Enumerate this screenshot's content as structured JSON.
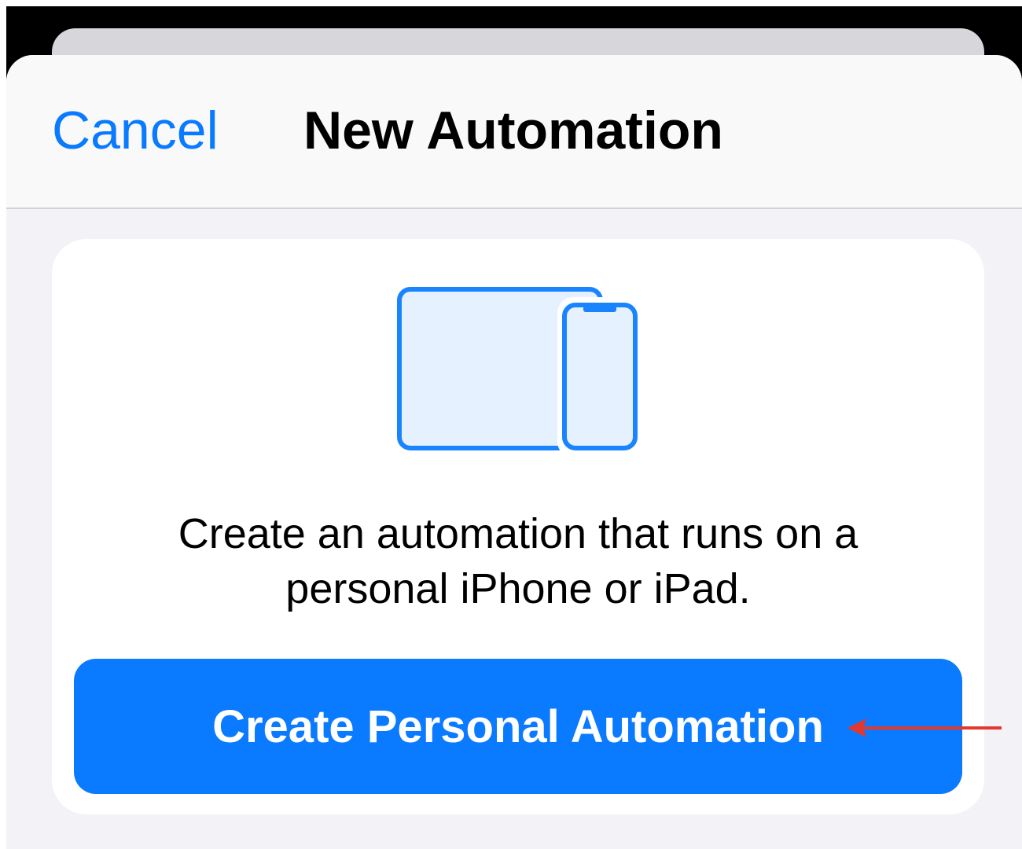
{
  "sheet": {
    "cancel_label": "Cancel",
    "title": "New Automation"
  },
  "card": {
    "icon": "ipad-and-iphone-icon",
    "description_line1": "Create an automation that runs on a",
    "description_line2": "personal iPhone or iPad.",
    "button_label": "Create Personal Automation"
  },
  "annotation": {
    "icon": "red-arrow-pointer",
    "color": "#e2382d"
  },
  "colors": {
    "accent": "#0a7aff",
    "sheet_background": "#f2f2f7",
    "card_background": "#ffffff",
    "device_fill": "#e5f1ff",
    "device_stroke": "#1a84ff"
  }
}
